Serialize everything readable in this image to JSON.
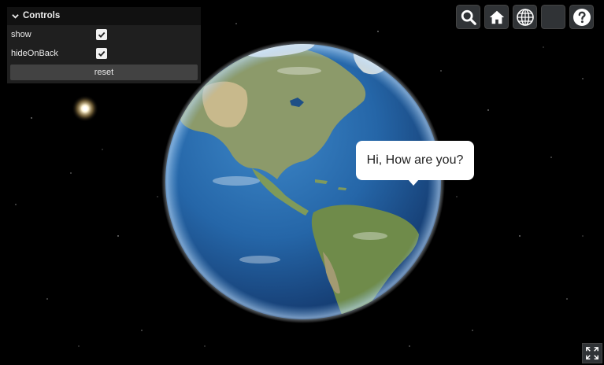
{
  "controls": {
    "title": "Controls",
    "rows": [
      {
        "label": "show",
        "checked": true
      },
      {
        "label": "hideOnBack",
        "checked": true
      }
    ],
    "reset_label": "reset"
  },
  "toolbar": {
    "buttons": [
      "search-icon",
      "home-icon",
      "globe-icon",
      "blank",
      "help-icon"
    ]
  },
  "bubble": {
    "text": "Hi, How are you?"
  },
  "colors": {
    "panel": "#1f1f1f",
    "panel_title": "#111111",
    "button_bg": "#303336",
    "ocean": "#2a6db0"
  }
}
